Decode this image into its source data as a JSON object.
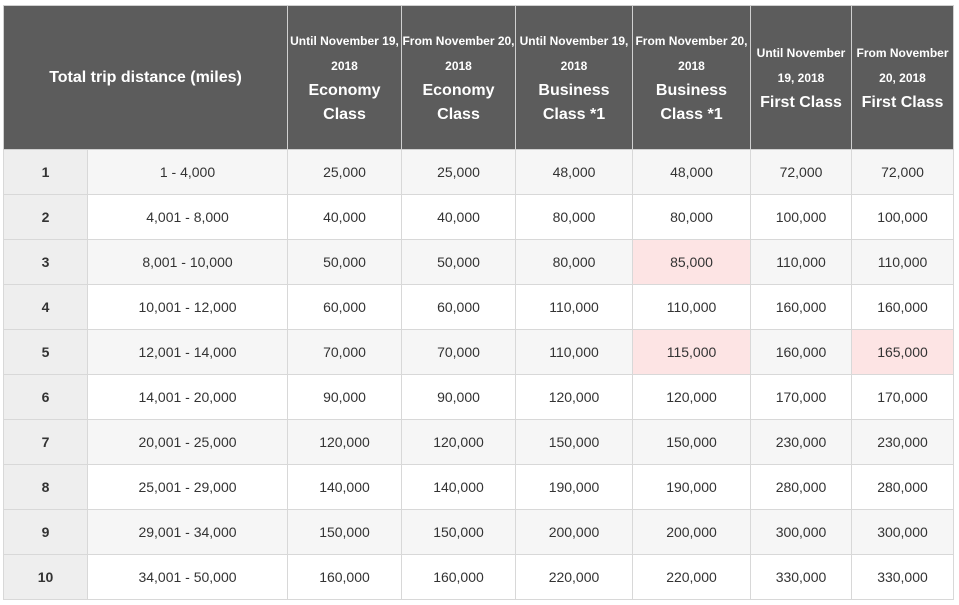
{
  "header": {
    "distance_label": "Total trip distance (miles)",
    "columns": [
      {
        "period": "Until November 19, 2018",
        "cabin": "Economy Class"
      },
      {
        "period": "From November 20, 2018",
        "cabin": "Economy Class"
      },
      {
        "period": "Until November 19, 2018",
        "cabin": "Business Class *1"
      },
      {
        "period": "From November 20, 2018",
        "cabin": "Business Class *1"
      },
      {
        "period": "Until November 19, 2018",
        "cabin": "First Class"
      },
      {
        "period": "From November 20, 2018",
        "cabin": "First Class"
      }
    ]
  },
  "rows": [
    {
      "zone": "1",
      "range": "1 - 4,000",
      "values": [
        "25,000",
        "25,000",
        "48,000",
        "48,000",
        "72,000",
        "72,000"
      ]
    },
    {
      "zone": "2",
      "range": "4,001 - 8,000",
      "values": [
        "40,000",
        "40,000",
        "80,000",
        "80,000",
        "100,000",
        "100,000"
      ]
    },
    {
      "zone": "3",
      "range": "8,001 - 10,000",
      "values": [
        "50,000",
        "50,000",
        "80,000",
        "85,000",
        "110,000",
        "110,000"
      ]
    },
    {
      "zone": "4",
      "range": "10,001 - 12,000",
      "values": [
        "60,000",
        "60,000",
        "110,000",
        "110,000",
        "160,000",
        "160,000"
      ]
    },
    {
      "zone": "5",
      "range": "12,001 - 14,000",
      "values": [
        "70,000",
        "70,000",
        "110,000",
        "115,000",
        "160,000",
        "165,000"
      ]
    },
    {
      "zone": "6",
      "range": "14,001 - 20,000",
      "values": [
        "90,000",
        "90,000",
        "120,000",
        "120,000",
        "170,000",
        "170,000"
      ]
    },
    {
      "zone": "7",
      "range": "20,001 - 25,000",
      "values": [
        "120,000",
        "120,000",
        "150,000",
        "150,000",
        "230,000",
        "230,000"
      ]
    },
    {
      "zone": "8",
      "range": "25,001 - 29,000",
      "values": [
        "140,000",
        "140,000",
        "190,000",
        "190,000",
        "280,000",
        "280,000"
      ]
    },
    {
      "zone": "9",
      "range": "29,001 - 34,000",
      "values": [
        "150,000",
        "150,000",
        "200,000",
        "200,000",
        "300,000",
        "300,000"
      ]
    },
    {
      "zone": "10",
      "range": "34,001 - 50,000",
      "values": [
        "160,000",
        "160,000",
        "220,000",
        "220,000",
        "330,000",
        "330,000"
      ]
    }
  ],
  "highlighted_cells": [
    {
      "row": 2,
      "col": 3
    },
    {
      "row": 4,
      "col": 3
    },
    {
      "row": 4,
      "col": 5
    }
  ],
  "colors": {
    "header_bg": "#5c5c5c",
    "highlight_bg": "#fde4e4"
  }
}
